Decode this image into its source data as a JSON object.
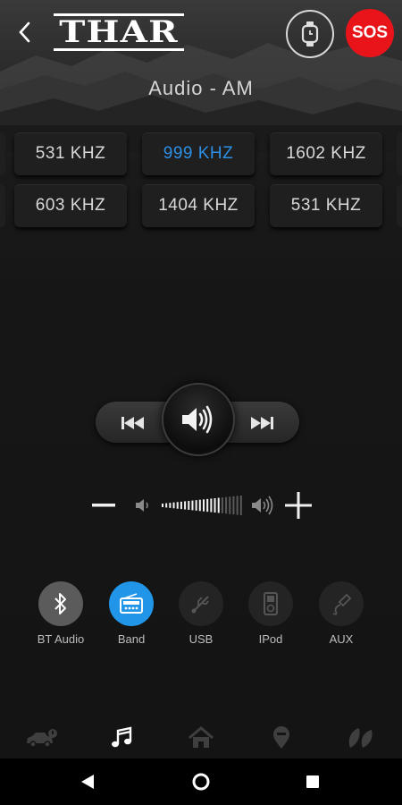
{
  "header": {
    "logo_text": "THAR",
    "sos_label": "SOS",
    "back_icon": "back-arrow-icon",
    "watch_icon": "smartwatch-icon"
  },
  "title": "Audio - AM",
  "presets": [
    {
      "label": "531 KHZ",
      "active": false
    },
    {
      "label": "999 KHZ",
      "active": true
    },
    {
      "label": "1602 KHZ",
      "active": false
    },
    {
      "label": "603 KHZ",
      "active": false
    },
    {
      "label": "1404 KHZ",
      "active": false
    },
    {
      "label": "531 KHZ",
      "active": false
    }
  ],
  "playback": {
    "prev_icon": "previous-track-icon",
    "next_icon": "next-track-icon",
    "volume_icon": "speaker-icon"
  },
  "volume": {
    "level": 0.72,
    "minus_icon": "minus-icon",
    "plus_icon": "plus-icon"
  },
  "sources": [
    {
      "label": "BT Audio",
      "icon": "bluetooth-icon",
      "state": "enabled"
    },
    {
      "label": "Band",
      "icon": "radio-icon",
      "state": "selected"
    },
    {
      "label": "USB",
      "icon": "usb-icon",
      "state": "disabled"
    },
    {
      "label": "IPod",
      "icon": "ipod-icon",
      "state": "disabled"
    },
    {
      "label": "AUX",
      "icon": "aux-cable-icon",
      "state": "disabled"
    }
  ],
  "bottom_nav": [
    {
      "icon": "vehicle-icon",
      "active": false
    },
    {
      "icon": "music-note-icon",
      "active": true
    },
    {
      "icon": "home-icon",
      "active": false
    },
    {
      "icon": "location-pin-icon",
      "active": false
    },
    {
      "icon": "leaf-icon",
      "active": false
    }
  ],
  "colors": {
    "accent_blue": "#2196e8",
    "sos_red": "#e8141a",
    "active_preset": "#2e8fe6"
  }
}
